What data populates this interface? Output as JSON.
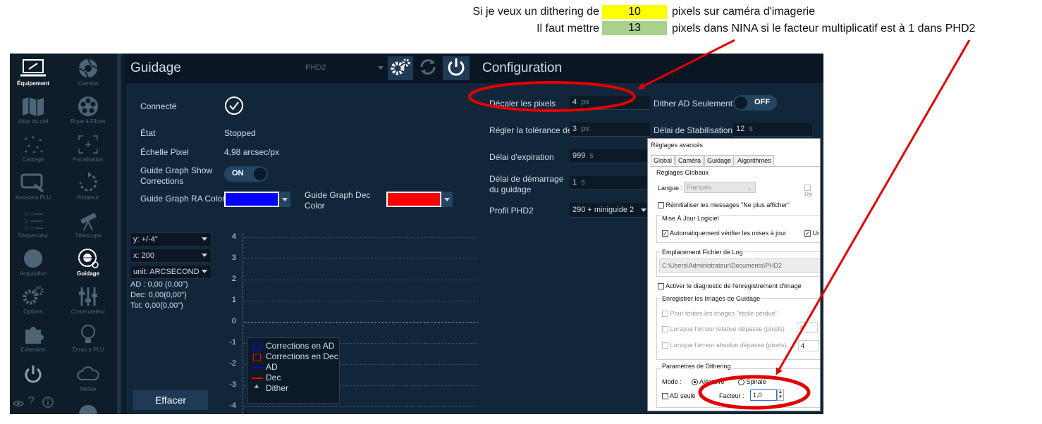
{
  "annotation": {
    "line1_prefix": "Si je veux un dithering de",
    "line1_value": "10",
    "line1_suffix": "pixels sur caméra d'imagerie",
    "line2_prefix": "Il faut mettre",
    "line2_value": "13",
    "line2_suffix": "pixels dans NINA si le facteur multiplicatif est à 1 dans PHD2",
    "highlight_yellow": "#ffff00",
    "highlight_green": "#a9d18e",
    "arrow_color": "#e00000"
  },
  "sidebar": {
    "items": [
      {
        "label": "Équipement",
        "icon": "laptop-icon",
        "active": true
      },
      {
        "label": "Caméra",
        "icon": "camera-aperture-icon"
      },
      {
        "label": "Atlas du ciel",
        "icon": "map-icon"
      },
      {
        "label": "Roue à Filtres",
        "icon": "filter-wheel-icon"
      },
      {
        "label": "Cadrage",
        "icon": "star-field-icon"
      },
      {
        "label": "Focalisation",
        "icon": "focus-icon"
      },
      {
        "label": "Assistant PLU",
        "icon": "flat-panel-icon"
      },
      {
        "label": "Rotateur",
        "icon": "rotate-icon"
      },
      {
        "label": "Séquenceur",
        "icon": "stars-list-icon"
      },
      {
        "label": "Télescope",
        "icon": "telescope-icon"
      },
      {
        "label": "Acquisition",
        "icon": "circle-icon"
      },
      {
        "label": "Guidage",
        "icon": "guide-target-icon",
        "active": true
      },
      {
        "label": "Options",
        "icon": "gears-icon"
      },
      {
        "label": "Commutateur",
        "icon": "sliders-icon"
      },
      {
        "label": "Extension",
        "icon": "puzzle-icon"
      },
      {
        "label": "Écran à PLU",
        "icon": "lightbulb-icon"
      },
      {
        "label": "",
        "icon": "power-icon"
      },
      {
        "label": "Météo",
        "icon": "cloud-icon"
      }
    ],
    "bottom_icons": [
      "eye-icon",
      "help-icon",
      "info-icon",
      "gauge-icon"
    ],
    "help_glyph": "?"
  },
  "guide": {
    "title": "Guidage",
    "selector": "PHD2",
    "connected_label": "Connecté",
    "state_label": "État",
    "state_value": "Stopped",
    "pixel_scale_label": "Échelle Pixel",
    "pixel_scale_value": "4,98 arcsec/px",
    "show_corrections_label_1": "Guide Graph Show",
    "show_corrections_label_2": "Corrections",
    "show_corrections_value": "ON",
    "ra_color_label": "Guide Graph RA Color",
    "ra_color": "#0000ff",
    "dec_color_label_1": "Guide Graph Dec",
    "dec_color_label_2": "Color",
    "dec_color": "#ff0000",
    "y_select": "y: +/-4\"",
    "x_select": "x: 200",
    "unit_select": "unit: ARCSECOND",
    "ad_stat": "AD : 0,00 (0,00\")",
    "dec_stat": "Dec: 0,00(0,00\")",
    "tot_stat": "Tot: 0,00(0,00\")",
    "clear_button": "Effacer",
    "y_ticks": [
      "4",
      "3",
      "2",
      "1",
      "0",
      "-1",
      "-2",
      "-3",
      "-4"
    ],
    "legend": {
      "corr_ad": "Corrections en AD",
      "corr_dec": "Corrections en Dec",
      "ad": "AD",
      "dec": "Dec",
      "dither": "Dither",
      "dither_glyph": "▲"
    }
  },
  "config": {
    "title": "Configuration",
    "shift_pixels_label": "Décaler les pixels",
    "shift_pixels_value": "4",
    "shift_pixels_unit": "px",
    "dither_ra_only_label": "Dither AD Seulement",
    "dither_ra_only_value": "OFF",
    "tolerance_label": "Régler la tolérance de",
    "tolerance_value": "3",
    "tolerance_unit": "px",
    "settle_label": "Délai de Stabilisation M",
    "settle_value": "12",
    "settle_unit": "s",
    "timeout_label": "Délai d'expiration",
    "timeout_value": "999",
    "timeout_unit": "s",
    "start_delay_label_1": "Délai de démarrage",
    "start_delay_label_2": "du guidage",
    "start_delay_value": "1",
    "start_delay_unit": "s",
    "profile_label": "Profil PHD2",
    "profile_value": "290 + miniguide 2"
  },
  "dialog": {
    "title": "Réglages avancés",
    "tabs": [
      "Global",
      "Caméra",
      "Guidage",
      "Algorithmes"
    ],
    "global_group": "Réglages Globaux",
    "language_label": "Langue :",
    "language_value": "Français",
    "right_cut_label": "Re",
    "reset_msgs": "Réinitialiser les messages \"Ne plus afficher\"",
    "update_group": "Mise À Jour Logiciel",
    "auto_check": "Automatiquement vérifier les mises à jour",
    "auto_check_cut": "Ur",
    "log_group": "Emplacement Fichier de Log",
    "log_path": "C:\\Users\\Administrateur\\Documents\\PHD2",
    "diag": "Activer le diagnostic de l'enregistrement d'image",
    "save_group": "Enregistrer les Images de Guidage",
    "save_all": "Pour toutes les images \"étoile perdue\"",
    "save_rel": "Lorsque l'erreur relative dépasse (pixels)",
    "save_rel_value": "4",
    "save_abs": "Lorsque l'erreur absolue dépasse (pixels)",
    "save_abs_value": "4",
    "dither_group": "Paramètres de Dithering",
    "mode_label": "Mode :",
    "mode_random": "Aléatoire",
    "mode_spiral": "Spirale",
    "ra_only": "AD seule",
    "factor_label": "Facteur :",
    "factor_value": "1,0"
  }
}
